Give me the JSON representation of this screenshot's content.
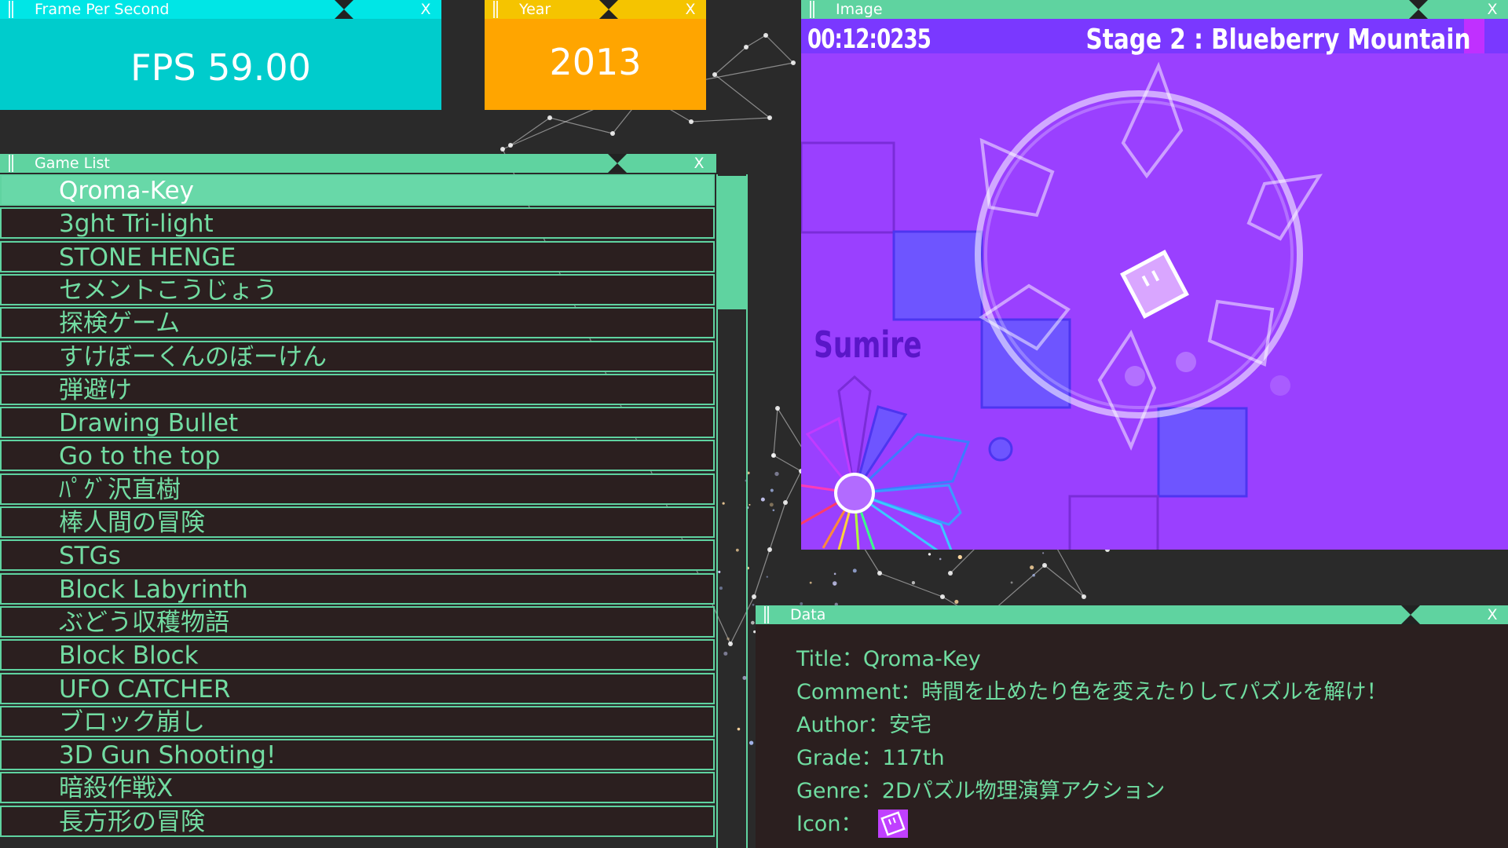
{
  "fps_window": {
    "title": "Frame Per Second",
    "close": "X",
    "value": "FPS 59.00"
  },
  "year_window": {
    "title": "Year",
    "close": "X",
    "value": "2013"
  },
  "image_window": {
    "title": "Image",
    "close": "X",
    "timer": "00:12:0235",
    "stage": "Stage 2 : Blueberry Mountain",
    "player": "Sumire"
  },
  "game_list_window": {
    "title": "Game List",
    "close": "X",
    "selected_index": 0,
    "items": [
      "Qroma-Key",
      "3ght Tri-light",
      "STONE HENGE",
      "セメントこうじょう",
      "探検ゲーム",
      "すけぼーくんのぼーけん",
      "弾避け",
      "Drawing Bullet",
      "Go to the top",
      "ﾊﾟｸﾞ沢直樹",
      "棒人間の冒険",
      "STGs",
      "Block Labyrinth",
      "ぶどう収穫物語",
      "Block Block",
      "UFO CATCHER",
      "ブロック崩し",
      "3D Gun Shooting!",
      "暗殺作戦X",
      "長方形の冒険"
    ]
  },
  "data_window": {
    "title": "Data",
    "close": "X",
    "title_line": "Title：Qroma-Key",
    "comment_line": "Comment：時間を止めたり色を変えたりしてパズルを解け！",
    "author_line": "Author：安宅",
    "grade_line": "Grade：117th",
    "genre_line": "Genre：2Dパズル物理演算アクション",
    "icon_label": "Icon：",
    "icon_name": "game-icon-square"
  },
  "colors": {
    "background": "#2a2a2a",
    "fps_panel": "#00cccc",
    "year_panel": "#ffa500",
    "accent_green": "#5fd3a0",
    "list_text": "#72dca2",
    "game_bg": "#9a40ff"
  }
}
